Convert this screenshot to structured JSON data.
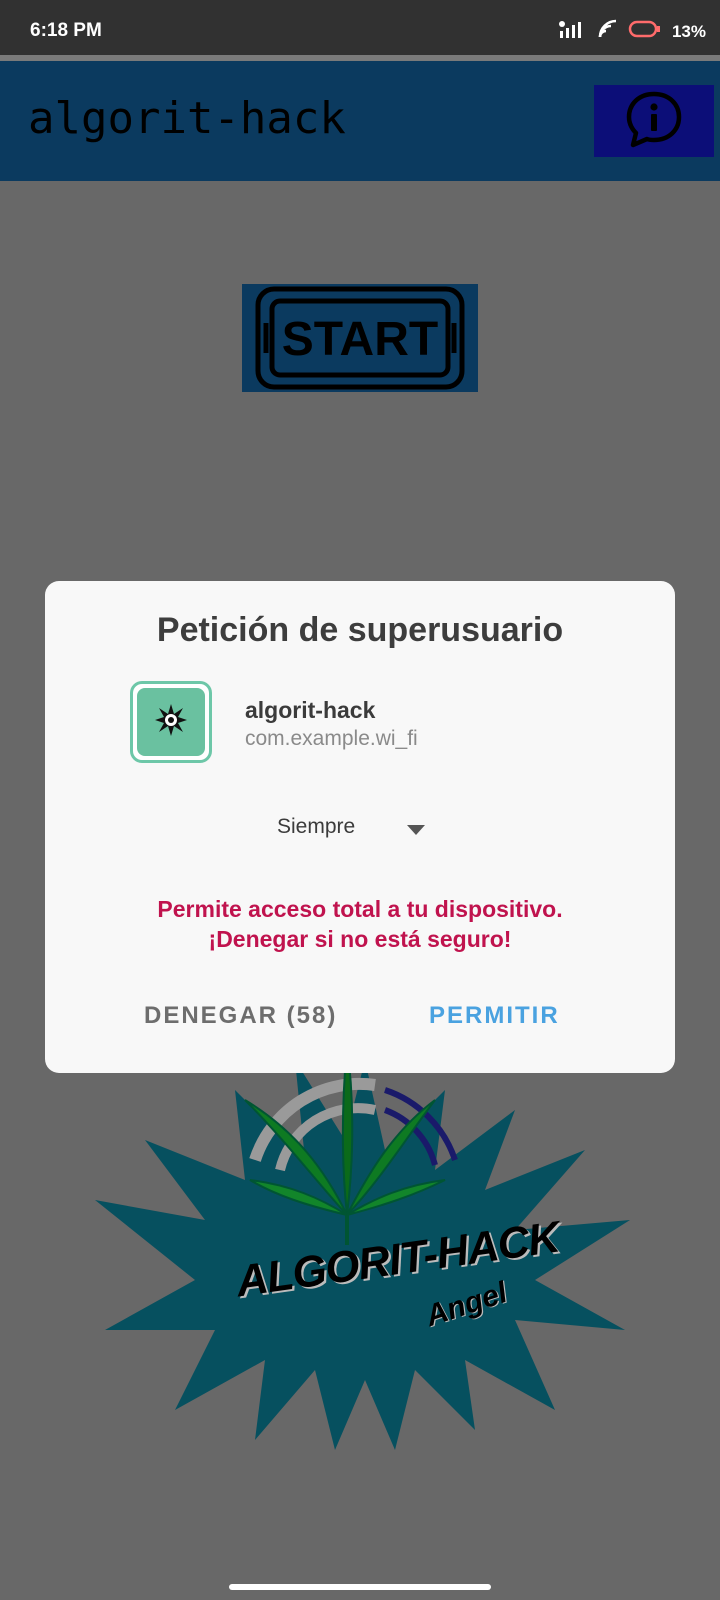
{
  "status_bar": {
    "time": "6:18 PM",
    "battery": "13%",
    "icons": [
      "signal-icon",
      "wifi-icon",
      "battery-icon"
    ]
  },
  "app_bar": {
    "title": "algorit-hack",
    "info_icon": "info-chat-icon"
  },
  "main": {
    "start_label": "START",
    "logo": {
      "title": "ALGORIT-HACK",
      "subtitle": "Angel"
    }
  },
  "dialog": {
    "title": "Petición de superusuario",
    "app_name": "algorit-hack",
    "app_package": "com.example.wi_fi",
    "duration": "Siempre",
    "warning_line1": "Permite acceso total a tu dispositivo.",
    "warning_line2": "¡Denegar si no está seguro!",
    "deny_label": "DENEGAR (58)",
    "allow_label": "PERMITIR"
  },
  "colors": {
    "app_bar": "#0b3a5f",
    "info_button": "#0c0e78",
    "warning": "#c0134e",
    "allow": "#4aa2e0",
    "deny": "#6d6d6d",
    "logo_burst": "#06505f"
  }
}
